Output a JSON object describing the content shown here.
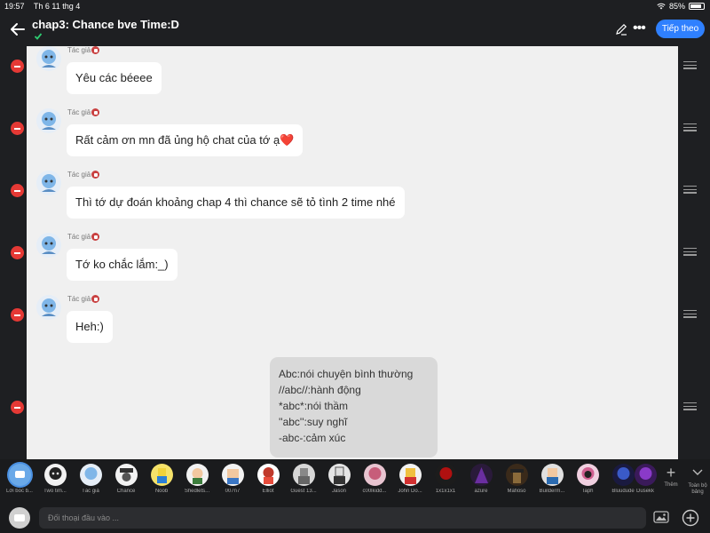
{
  "status": {
    "time": "19:57",
    "date": "Th 6 11 thg 4",
    "battery": "85%",
    "battery_level": 0.85
  },
  "header": {
    "title": "chap3: Chance bve Time:D",
    "follow_label": "Tiếp theo"
  },
  "messages": [
    {
      "author": "Tác giả",
      "text": "Yêu các béeee"
    },
    {
      "author": "Tác giả",
      "text": "Rất cảm ơn mn đã ủng hộ chat của tớ ạ",
      "emoji": "❤️"
    },
    {
      "author": "Tác giả",
      "text": "Thì tớ dự đoán khoảng chap 4 thì chance sẽ tỏ tình 2 time nhé"
    },
    {
      "author": "Tác giả",
      "text": "Tớ ko chắc lắm:_)"
    },
    {
      "author": "Tác giả",
      "text": "Heh:)"
    }
  ],
  "note": {
    "lines": [
      "Abc:nói chuyện bình thường",
      "//abc//:hành động",
      "*abc*:nói thầm",
      "''abc'':suy nghĩ",
      "-abc-:cảm xúc"
    ]
  },
  "characters": [
    {
      "name": "Lời bốc b...",
      "selected": true
    },
    {
      "name": "Two tim..."
    },
    {
      "name": "Tác giả"
    },
    {
      "name": "Chance"
    },
    {
      "name": "Noob"
    },
    {
      "name": "Shedlets..."
    },
    {
      "name": "007n7"
    },
    {
      "name": "Elliot"
    },
    {
      "name": "Guest 13..."
    },
    {
      "name": "Jason"
    },
    {
      "name": "c00lkidd..."
    },
    {
      "name": "John Do..."
    },
    {
      "name": "1x1x1x1"
    },
    {
      "name": "azure"
    },
    {
      "name": "Mafioso"
    },
    {
      "name": "Builderm..."
    },
    {
      "name": "Taph"
    },
    {
      "name": "Bluudude"
    },
    {
      "name": "Dusekk"
    }
  ],
  "add_label": "Thêm",
  "all_label": "Toàn bộ bảng",
  "input": {
    "placeholder": "Đối thoại đầu vào ..."
  }
}
